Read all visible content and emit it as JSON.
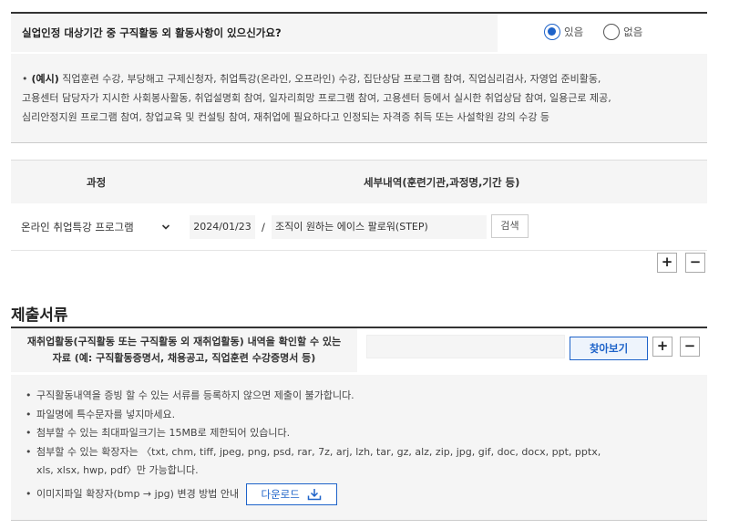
{
  "question": {
    "label": "실업인정 대상기간 중 구직활동 외 활동사항이 있으신가요?",
    "options": [
      {
        "label": "있음",
        "checked": true
      },
      {
        "label": "없음",
        "checked": false
      }
    ]
  },
  "example": {
    "prefix": "(예시)",
    "line1": "직업훈련 수강, 부당해고 구제신청자, 취업특강(온라인, 오프라인) 수강, 집단상담 프로그램 참여, 직업심리검사, 자영업 준비활동,",
    "line2": "고용센터 담당자가 지시한 사회봉사활동, 취업설명회 참여, 일자리희망 프로그램 참여, 고용센터 등에서 실시한 취업상담 참여, 일용근로 제공,",
    "line3": "심리안정지원 프로그램 참여, 창업교육 및 컨설팅 참여, 재취업에 필요하다고 인정되는 자격증 취득 또는 사설학원 강의 수강 등"
  },
  "course_table": {
    "headers": {
      "course": "과정",
      "detail": "세부내역(훈련기관,과정명,기간 등)"
    },
    "row": {
      "course_select": "온라인 취업특강 프로그램",
      "date": "2024/01/23",
      "separator": "/",
      "detail": "조직이 원하는 에이스 팔로워(STEP)",
      "search_label": "검색"
    },
    "add_label": "+",
    "remove_label": "−"
  },
  "documents": {
    "title": "제출서류",
    "label_line1": "재취업활동(구직활동 또는 구직활동 외 재취업활동) 내역을 확인할 수 있는",
    "label_line2": "자료 (예: 구직활동증명서, 채용공고, 직업훈련 수강증명서 등)",
    "file_value": "",
    "browse_label": "찾아보기",
    "add_label": "+",
    "remove_label": "−"
  },
  "notices": [
    "구직활동내역을 증빙 할 수 있는 서류를 등록하지 않으면 제출이 불가합니다.",
    "파일명에 특수문자를 넣지마세요.",
    "첨부할 수 있는 최대파일크기는 15MB로 제한되어 있습니다.",
    "첨부할 수 있는 확장자는 〈txt, chm, tiff, jpeg, png, psd, rar, 7z, arj, lzh, tar, gz, alz, zip, jpg, gif, doc, docx, ppt, pptx,",
    "xls, xlsx, hwp, pdf〉만 가능합니다.",
    "이미지파일 확장자(bmp → jpg) 변경 방법 안내"
  ],
  "download_label": "다운로드",
  "colors": {
    "accent": "#1e63c9",
    "panel": "#f5f5f5"
  }
}
